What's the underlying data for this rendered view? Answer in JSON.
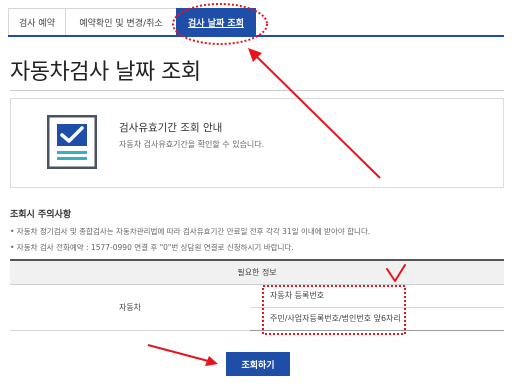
{
  "tabs": [
    {
      "label": "검사 예약"
    },
    {
      "label": "예약확인 및 변경/취소"
    },
    {
      "label": "검사 날짜 조회"
    }
  ],
  "page": {
    "title": "자동차검사 날짜 조회"
  },
  "info": {
    "title": "검사유효기간 조회 안내",
    "description": "자동차 검사유효기간을 확인할 수 있습니다.",
    "icon": "checklist-document-icon"
  },
  "notice": {
    "title": "조회시 주의사항",
    "items": [
      "• 자동차 정기검사 및 종합검사는 자동차관리법에 따라 검사유효기간 만료일 전후 각각 31일 이내에 받아야 합니다.",
      "• 자동차 검사 전화예약 : 1577-0990 연결 후 \"0\"번 상담원 연결로 신청하시기 바랍니다."
    ]
  },
  "table": {
    "header": "필요한 정보",
    "row_label": "자동차",
    "fields": [
      "자동차 등록번호",
      "주민/사업자등록번호/법인번호 앞6자리"
    ]
  },
  "button": {
    "search_label": "조회하기"
  },
  "colors": {
    "accent": "#1e4ea8",
    "annotation": "#e8141c"
  }
}
